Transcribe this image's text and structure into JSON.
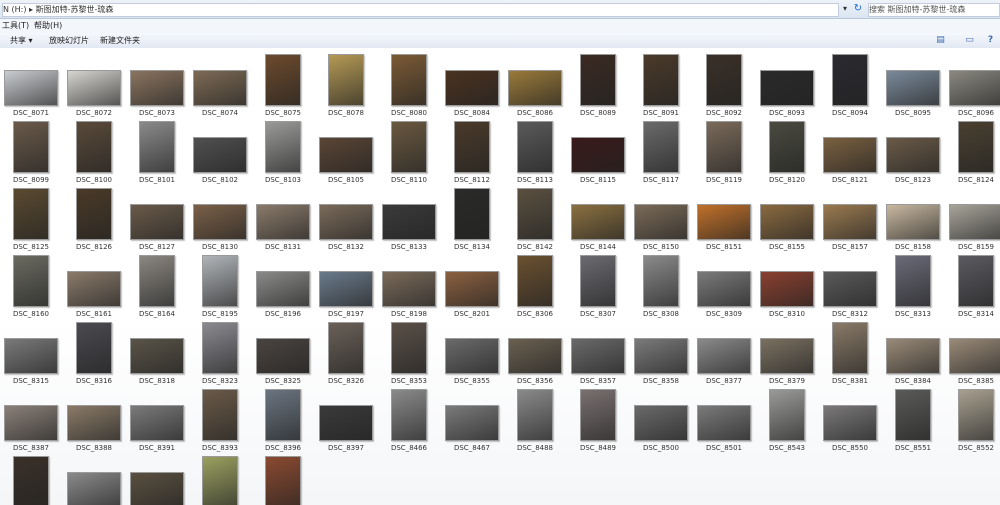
{
  "address_bar": {
    "path_text": "N (H:) ▸ 斯图加特-苏黎世-琉森",
    "dropdown": "▾",
    "search_placeholder": "搜索 斯图加特-苏黎世-琉森"
  },
  "menu": {
    "tools": "工具(T)",
    "help": "帮助(H)"
  },
  "toolbar": {
    "share": "共享",
    "share_arrow": "▾",
    "slideshow": "放映幻灯片",
    "new_folder": "新建文件夹"
  },
  "icons": {
    "views": "▤",
    "preview_pane": "▭",
    "help": "?",
    "refresh": "↻"
  },
  "photos": [
    {
      "name": "DSC_8071",
      "orient": "l",
      "tone": "#c9ccd0"
    },
    {
      "name": "DSC_8072",
      "orient": "l",
      "tone": "#d7d5d0"
    },
    {
      "name": "DSC_8073",
      "orient": "l",
      "tone": "#8a7460"
    },
    {
      "name": "DSC_8074",
      "orient": "l",
      "tone": "#7d6a55"
    },
    {
      "name": "DSC_8075",
      "orient": "p",
      "tone": "#6b4a2c"
    },
    {
      "name": "DSC_8078",
      "orient": "p",
      "tone": "#b59a55"
    },
    {
      "name": "DSC_8080",
      "orient": "p",
      "tone": "#7a5a35"
    },
    {
      "name": "DSC_8084",
      "orient": "l",
      "tone": "#4a3220"
    },
    {
      "name": "DSC_8086",
      "orient": "l",
      "tone": "#9a7a3a"
    },
    {
      "name": "DSC_8089",
      "orient": "p",
      "tone": "#3a2a22"
    },
    {
      "name": "DSC_8091",
      "orient": "p",
      "tone": "#4a3a2a"
    },
    {
      "name": "DSC_8092",
      "orient": "p",
      "tone": "#3a3028"
    },
    {
      "name": "DSC_8093",
      "orient": "l",
      "tone": "#2b2a2a"
    },
    {
      "name": "DSC_8094",
      "orient": "p",
      "tone": "#2a2a30"
    },
    {
      "name": "DSC_8095",
      "orient": "l",
      "tone": "#7a8a9a"
    },
    {
      "name": "DSC_8096",
      "orient": "l",
      "tone": "#8a8880"
    },
    {
      "name": "DSC_8099",
      "orient": "p",
      "tone": "#6a5a4a"
    },
    {
      "name": "DSC_8100",
      "orient": "p",
      "tone": "#5a4a3a"
    },
    {
      "name": "DSC_8101",
      "orient": "p",
      "tone": "#8a8a8a"
    },
    {
      "name": "DSC_8102",
      "orient": "l",
      "tone": "#505050"
    },
    {
      "name": "DSC_8103",
      "orient": "p",
      "tone": "#9a9a98"
    },
    {
      "name": "DSC_8105",
      "orient": "l",
      "tone": "#5a4535"
    },
    {
      "name": "DSC_8110",
      "orient": "p",
      "tone": "#6a5840"
    },
    {
      "name": "DSC_8112",
      "orient": "p",
      "tone": "#4a3a2a"
    },
    {
      "name": "DSC_8113",
      "orient": "p",
      "tone": "#5a5a5a"
    },
    {
      "name": "DSC_8115",
      "orient": "l",
      "tone": "#3a1a1a"
    },
    {
      "name": "DSC_8117",
      "orient": "p",
      "tone": "#6a6a6a"
    },
    {
      "name": "DSC_8119",
      "orient": "p",
      "tone": "#7a6a5a"
    },
    {
      "name": "DSC_8120",
      "orient": "p",
      "tone": "#4a4a40"
    },
    {
      "name": "DSC_8121",
      "orient": "l",
      "tone": "#7a6040"
    },
    {
      "name": "DSC_8123",
      "orient": "l",
      "tone": "#6a5a48"
    },
    {
      "name": "DSC_8124",
      "orient": "p",
      "tone": "#4a4030"
    },
    {
      "name": "DSC_8125",
      "orient": "p",
      "tone": "#5a4a30"
    },
    {
      "name": "DSC_8126",
      "orient": "p",
      "tone": "#4a3a28"
    },
    {
      "name": "DSC_8127",
      "orient": "l",
      "tone": "#6a5a4a"
    },
    {
      "name": "DSC_8130",
      "orient": "l",
      "tone": "#7a6048"
    },
    {
      "name": "DSC_8131",
      "orient": "l",
      "tone": "#8a7a6a"
    },
    {
      "name": "DSC_8132",
      "orient": "l",
      "tone": "#7a6a5a"
    },
    {
      "name": "DSC_8133",
      "orient": "l",
      "tone": "#3a3a3a"
    },
    {
      "name": "DSC_8134",
      "orient": "p",
      "tone": "#2a2a28"
    },
    {
      "name": "DSC_8142",
      "orient": "p",
      "tone": "#5a5040"
    },
    {
      "name": "DSC_8144",
      "orient": "l",
      "tone": "#8a7040"
    },
    {
      "name": "DSC_8150",
      "orient": "l",
      "tone": "#7a6a58"
    },
    {
      "name": "DSC_8151",
      "orient": "l",
      "tone": "#c0702a"
    },
    {
      "name": "DSC_8155",
      "orient": "l",
      "tone": "#8a6a40"
    },
    {
      "name": "DSC_8157",
      "orient": "l",
      "tone": "#9a7a50"
    },
    {
      "name": "DSC_8158",
      "orient": "l",
      "tone": "#c8b8a0"
    },
    {
      "name": "DSC_8159",
      "orient": "l",
      "tone": "#a8a49a"
    },
    {
      "name": "DSC_8160",
      "orient": "p",
      "tone": "#6a6a60"
    },
    {
      "name": "DSC_8161",
      "orient": "l",
      "tone": "#8a7a6a"
    },
    {
      "name": "DSC_8164",
      "orient": "p",
      "tone": "#8a8680"
    },
    {
      "name": "DSC_8195",
      "orient": "p",
      "tone": "#b0b4b8"
    },
    {
      "name": "DSC_8196",
      "orient": "l",
      "tone": "#8a8a88"
    },
    {
      "name": "DSC_8197",
      "orient": "l",
      "tone": "#6a7a8a"
    },
    {
      "name": "DSC_8198",
      "orient": "l",
      "tone": "#7a6a5a"
    },
    {
      "name": "DSC_8201",
      "orient": "l",
      "tone": "#8a6040"
    },
    {
      "name": "DSC_8306",
      "orient": "p",
      "tone": "#6a5030"
    },
    {
      "name": "DSC_8307",
      "orient": "p",
      "tone": "#6a6a70"
    },
    {
      "name": "DSC_8308",
      "orient": "p",
      "tone": "#8a8a8a"
    },
    {
      "name": "DSC_8309",
      "orient": "l",
      "tone": "#7a7a7a"
    },
    {
      "name": "DSC_8310",
      "orient": "l",
      "tone": "#8a4030"
    },
    {
      "name": "DSC_8312",
      "orient": "l",
      "tone": "#5a5a5a"
    },
    {
      "name": "DSC_8313",
      "orient": "p",
      "tone": "#6a6a78"
    },
    {
      "name": "DSC_8314",
      "orient": "p",
      "tone": "#5a5a60"
    },
    {
      "name": "DSC_8315",
      "orient": "l",
      "tone": "#7a7a7a"
    },
    {
      "name": "DSC_8316",
      "orient": "p",
      "tone": "#4a4a50"
    },
    {
      "name": "DSC_8318",
      "orient": "l",
      "tone": "#5a5448"
    },
    {
      "name": "DSC_8323",
      "orient": "p",
      "tone": "#8a8a90"
    },
    {
      "name": "DSC_8325",
      "orient": "l",
      "tone": "#4a4440"
    },
    {
      "name": "DSC_8326",
      "orient": "p",
      "tone": "#6a6058"
    },
    {
      "name": "DSC_8353",
      "orient": "p",
      "tone": "#5a5048"
    },
    {
      "name": "DSC_8355",
      "orient": "l",
      "tone": "#6a6a6a"
    },
    {
      "name": "DSC_8356",
      "orient": "l",
      "tone": "#6a6050"
    },
    {
      "name": "DSC_8357",
      "orient": "l",
      "tone": "#6a6a6a"
    },
    {
      "name": "DSC_8358",
      "orient": "l",
      "tone": "#7a7a7a"
    },
    {
      "name": "DSC_8377",
      "orient": "l",
      "tone": "#8a8a8a"
    },
    {
      "name": "DSC_8379",
      "orient": "l",
      "tone": "#7a7060"
    },
    {
      "name": "DSC_8381",
      "orient": "p",
      "tone": "#8a7a68"
    },
    {
      "name": "DSC_8384",
      "orient": "l",
      "tone": "#9a8a78"
    },
    {
      "name": "DSC_8385",
      "orient": "l",
      "tone": "#9a8a78"
    },
    {
      "name": "DSC_8387",
      "orient": "l",
      "tone": "#8a8078"
    },
    {
      "name": "DSC_8388",
      "orient": "l",
      "tone": "#8a7a68"
    },
    {
      "name": "DSC_8391",
      "orient": "l",
      "tone": "#7a7a7a"
    },
    {
      "name": "DSC_8393",
      "orient": "p",
      "tone": "#6a5a48"
    },
    {
      "name": "DSC_8396",
      "orient": "p",
      "tone": "#6a7480"
    },
    {
      "name": "DSC_8397",
      "orient": "l",
      "tone": "#3a3a3a"
    },
    {
      "name": "DSC_8466",
      "orient": "p",
      "tone": "#8a8a8a"
    },
    {
      "name": "DSC_8467",
      "orient": "l",
      "tone": "#7a7a7a"
    },
    {
      "name": "DSC_8488",
      "orient": "p",
      "tone": "#8a8a8a"
    },
    {
      "name": "DSC_8489",
      "orient": "p",
      "tone": "#7a7070"
    },
    {
      "name": "DSC_8500",
      "orient": "l",
      "tone": "#6a6a6a"
    },
    {
      "name": "DSC_8501",
      "orient": "l",
      "tone": "#7a7a7a"
    },
    {
      "name": "DSC_8543",
      "orient": "p",
      "tone": "#9a9a98"
    },
    {
      "name": "DSC_8550",
      "orient": "l",
      "tone": "#7a7878"
    },
    {
      "name": "DSC_8551",
      "orient": "p",
      "tone": "#5a5a58"
    },
    {
      "name": "DSC_8552",
      "orient": "p",
      "tone": "#a8a090"
    },
    {
      "name": "",
      "orient": "p",
      "tone": "#3a3028"
    },
    {
      "name": "",
      "orient": "l",
      "tone": "#8a8a8a"
    },
    {
      "name": "",
      "orient": "l",
      "tone": "#5a5040"
    },
    {
      "name": "",
      "orient": "p",
      "tone": "#9aa060"
    },
    {
      "name": "",
      "orient": "p",
      "tone": "#8a4a30"
    }
  ]
}
